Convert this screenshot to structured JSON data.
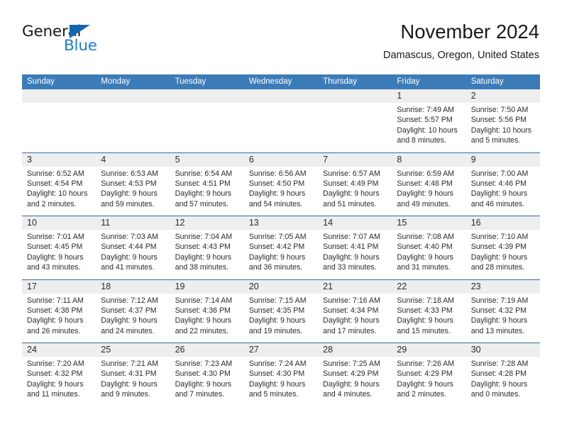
{
  "brand": {
    "name_dark": "General",
    "name_blue": "Blue",
    "triangle_color": "#1267b1",
    "blue_color": "#1b7fd4"
  },
  "header": {
    "title": "November 2024",
    "subtitle": "Damascus, Oregon, United States"
  },
  "theme": {
    "header_bg": "#3b7cb8",
    "week_separator": "#2f6da6",
    "daynum_band": "#eeeeee",
    "text": "#2a2a2a"
  },
  "calendar": {
    "weekday_headers": [
      "Sunday",
      "Monday",
      "Tuesday",
      "Wednesday",
      "Thursday",
      "Friday",
      "Saturday"
    ],
    "weeks": [
      [
        {
          "day": ""
        },
        {
          "day": ""
        },
        {
          "day": ""
        },
        {
          "day": ""
        },
        {
          "day": ""
        },
        {
          "day": "1",
          "sunrise": "Sunrise: 7:49 AM",
          "sunset": "Sunset: 5:57 PM",
          "daylight1": "Daylight: 10 hours",
          "daylight2": "and 8 minutes."
        },
        {
          "day": "2",
          "sunrise": "Sunrise: 7:50 AM",
          "sunset": "Sunset: 5:56 PM",
          "daylight1": "Daylight: 10 hours",
          "daylight2": "and 5 minutes."
        }
      ],
      [
        {
          "day": "3",
          "sunrise": "Sunrise: 6:52 AM",
          "sunset": "Sunset: 4:54 PM",
          "daylight1": "Daylight: 10 hours",
          "daylight2": "and 2 minutes."
        },
        {
          "day": "4",
          "sunrise": "Sunrise: 6:53 AM",
          "sunset": "Sunset: 4:53 PM",
          "daylight1": "Daylight: 9 hours",
          "daylight2": "and 59 minutes."
        },
        {
          "day": "5",
          "sunrise": "Sunrise: 6:54 AM",
          "sunset": "Sunset: 4:51 PM",
          "daylight1": "Daylight: 9 hours",
          "daylight2": "and 57 minutes."
        },
        {
          "day": "6",
          "sunrise": "Sunrise: 6:56 AM",
          "sunset": "Sunset: 4:50 PM",
          "daylight1": "Daylight: 9 hours",
          "daylight2": "and 54 minutes."
        },
        {
          "day": "7",
          "sunrise": "Sunrise: 6:57 AM",
          "sunset": "Sunset: 4:49 PM",
          "daylight1": "Daylight: 9 hours",
          "daylight2": "and 51 minutes."
        },
        {
          "day": "8",
          "sunrise": "Sunrise: 6:59 AM",
          "sunset": "Sunset: 4:48 PM",
          "daylight1": "Daylight: 9 hours",
          "daylight2": "and 49 minutes."
        },
        {
          "day": "9",
          "sunrise": "Sunrise: 7:00 AM",
          "sunset": "Sunset: 4:46 PM",
          "daylight1": "Daylight: 9 hours",
          "daylight2": "and 46 minutes."
        }
      ],
      [
        {
          "day": "10",
          "sunrise": "Sunrise: 7:01 AM",
          "sunset": "Sunset: 4:45 PM",
          "daylight1": "Daylight: 9 hours",
          "daylight2": "and 43 minutes."
        },
        {
          "day": "11",
          "sunrise": "Sunrise: 7:03 AM",
          "sunset": "Sunset: 4:44 PM",
          "daylight1": "Daylight: 9 hours",
          "daylight2": "and 41 minutes."
        },
        {
          "day": "12",
          "sunrise": "Sunrise: 7:04 AM",
          "sunset": "Sunset: 4:43 PM",
          "daylight1": "Daylight: 9 hours",
          "daylight2": "and 38 minutes."
        },
        {
          "day": "13",
          "sunrise": "Sunrise: 7:05 AM",
          "sunset": "Sunset: 4:42 PM",
          "daylight1": "Daylight: 9 hours",
          "daylight2": "and 36 minutes."
        },
        {
          "day": "14",
          "sunrise": "Sunrise: 7:07 AM",
          "sunset": "Sunset: 4:41 PM",
          "daylight1": "Daylight: 9 hours",
          "daylight2": "and 33 minutes."
        },
        {
          "day": "15",
          "sunrise": "Sunrise: 7:08 AM",
          "sunset": "Sunset: 4:40 PM",
          "daylight1": "Daylight: 9 hours",
          "daylight2": "and 31 minutes."
        },
        {
          "day": "16",
          "sunrise": "Sunrise: 7:10 AM",
          "sunset": "Sunset: 4:39 PM",
          "daylight1": "Daylight: 9 hours",
          "daylight2": "and 28 minutes."
        }
      ],
      [
        {
          "day": "17",
          "sunrise": "Sunrise: 7:11 AM",
          "sunset": "Sunset: 4:38 PM",
          "daylight1": "Daylight: 9 hours",
          "daylight2": "and 26 minutes."
        },
        {
          "day": "18",
          "sunrise": "Sunrise: 7:12 AM",
          "sunset": "Sunset: 4:37 PM",
          "daylight1": "Daylight: 9 hours",
          "daylight2": "and 24 minutes."
        },
        {
          "day": "19",
          "sunrise": "Sunrise: 7:14 AM",
          "sunset": "Sunset: 4:36 PM",
          "daylight1": "Daylight: 9 hours",
          "daylight2": "and 22 minutes."
        },
        {
          "day": "20",
          "sunrise": "Sunrise: 7:15 AM",
          "sunset": "Sunset: 4:35 PM",
          "daylight1": "Daylight: 9 hours",
          "daylight2": "and 19 minutes."
        },
        {
          "day": "21",
          "sunrise": "Sunrise: 7:16 AM",
          "sunset": "Sunset: 4:34 PM",
          "daylight1": "Daylight: 9 hours",
          "daylight2": "and 17 minutes."
        },
        {
          "day": "22",
          "sunrise": "Sunrise: 7:18 AM",
          "sunset": "Sunset: 4:33 PM",
          "daylight1": "Daylight: 9 hours",
          "daylight2": "and 15 minutes."
        },
        {
          "day": "23",
          "sunrise": "Sunrise: 7:19 AM",
          "sunset": "Sunset: 4:32 PM",
          "daylight1": "Daylight: 9 hours",
          "daylight2": "and 13 minutes."
        }
      ],
      [
        {
          "day": "24",
          "sunrise": "Sunrise: 7:20 AM",
          "sunset": "Sunset: 4:32 PM",
          "daylight1": "Daylight: 9 hours",
          "daylight2": "and 11 minutes."
        },
        {
          "day": "25",
          "sunrise": "Sunrise: 7:21 AM",
          "sunset": "Sunset: 4:31 PM",
          "daylight1": "Daylight: 9 hours",
          "daylight2": "and 9 minutes."
        },
        {
          "day": "26",
          "sunrise": "Sunrise: 7:23 AM",
          "sunset": "Sunset: 4:30 PM",
          "daylight1": "Daylight: 9 hours",
          "daylight2": "and 7 minutes."
        },
        {
          "day": "27",
          "sunrise": "Sunrise: 7:24 AM",
          "sunset": "Sunset: 4:30 PM",
          "daylight1": "Daylight: 9 hours",
          "daylight2": "and 5 minutes."
        },
        {
          "day": "28",
          "sunrise": "Sunrise: 7:25 AM",
          "sunset": "Sunset: 4:29 PM",
          "daylight1": "Daylight: 9 hours",
          "daylight2": "and 4 minutes."
        },
        {
          "day": "29",
          "sunrise": "Sunrise: 7:26 AM",
          "sunset": "Sunset: 4:29 PM",
          "daylight1": "Daylight: 9 hours",
          "daylight2": "and 2 minutes."
        },
        {
          "day": "30",
          "sunrise": "Sunrise: 7:28 AM",
          "sunset": "Sunset: 4:28 PM",
          "daylight1": "Daylight: 9 hours",
          "daylight2": "and 0 minutes."
        }
      ]
    ]
  }
}
